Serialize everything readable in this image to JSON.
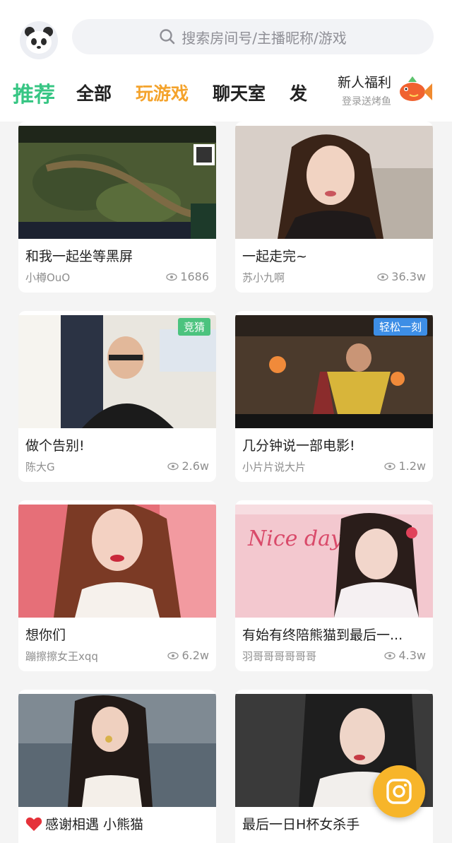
{
  "header": {
    "search_placeholder": "搜索房间号/主播昵称/游戏",
    "tabs": [
      "推荐",
      "全部",
      "玩游戏",
      "聊天室",
      "发"
    ],
    "promo_title": "新人福利",
    "promo_sub": "登录送烤鱼"
  },
  "colors": {
    "accent_green": "#38c684",
    "accent_orange": "#f4a32c",
    "fab": "#f7b52a"
  },
  "cards": [
    {
      "title": "和我一起坐等黑屏",
      "author": "小樽OuO",
      "views": "1686",
      "badge": ""
    },
    {
      "title": "一起走完~",
      "author": "苏小九啊",
      "views": "36.3w",
      "badge": ""
    },
    {
      "title": "做个告别!",
      "author": "陈大G",
      "views": "2.6w",
      "badge": "竞猜"
    },
    {
      "title": "几分钟说一部电影!",
      "author": "小片片说大片",
      "views": "1.2w",
      "badge": "轻松一刻"
    },
    {
      "title": "想你们",
      "author": "蹦擦擦女王xqq",
      "views": "6.2w",
      "badge": ""
    },
    {
      "title": "有始有终陪熊猫到最后一...",
      "author": "羽哥哥哥哥哥哥",
      "views": "4.3w",
      "badge": ""
    },
    {
      "title": "感谢相遇 小熊猫",
      "author": "",
      "views": "",
      "badge": ""
    },
    {
      "title": "最后一日H杯女杀手",
      "author": "",
      "views": "",
      "badge": ""
    }
  ],
  "thumb_overlay_text": {
    "nice_day": "Nice day"
  },
  "icons": {
    "search": "search-icon",
    "views": "eye-icon",
    "promo": "fish-icon",
    "fab": "camera-icon"
  }
}
